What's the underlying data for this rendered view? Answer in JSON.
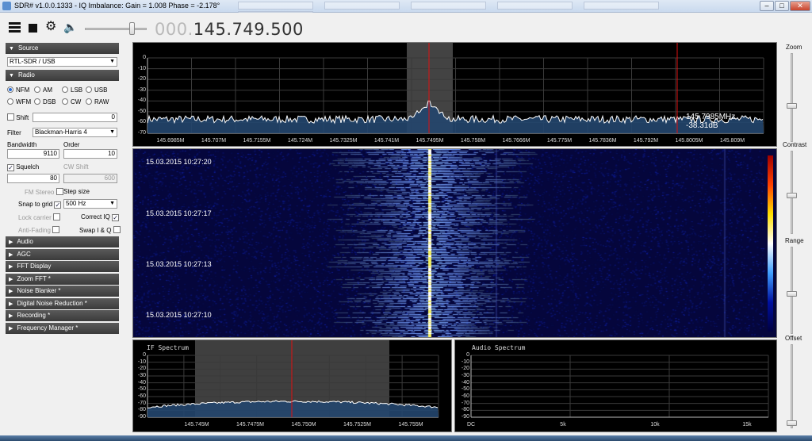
{
  "window": {
    "title": "SDR# v1.0.0.1333 - IQ Imbalance: Gain = 1.008 Phase = -2.178°",
    "min_label": "–",
    "max_label": "□",
    "close_label": "✕"
  },
  "toolbar": {
    "menu_icon": "hamburger-icon",
    "stop_icon": "stop-icon",
    "settings_icon": "gear-icon",
    "audio_icon": "speaker-icon",
    "volume": 0.75,
    "frequency_dim": "000.",
    "frequency_main": "145.749.500"
  },
  "left": {
    "source_header": "Source",
    "source_device": "RTL-SDR / USB",
    "radio_header": "Radio",
    "modes": [
      "NFM",
      "AM",
      "LSB",
      "USB",
      "WFM",
      "DSB",
      "CW",
      "RAW"
    ],
    "selected_mode": "NFM",
    "shift_label": "Shift",
    "shift_value": "0",
    "filter_label": "Filter",
    "filter_value": "Blackman-Harris 4",
    "bandwidth_label": "Bandwidth",
    "bandwidth_value": "9110",
    "order_label": "Order",
    "order_value": "10",
    "squelch_label": "Squelch",
    "squelch_value": "80",
    "cwshift_label": "CW Shift",
    "cwshift_value": "600",
    "fmstereo_label": "FM Stereo",
    "stepsize_label": "Step size",
    "snap_label": "Snap to grid",
    "step_value": "500 Hz",
    "lock_label": "Lock carrier",
    "correctiq_label": "Correct IQ",
    "antifading_label": "Anti-Fading",
    "swapiq_label": "Swap I & Q",
    "sections": [
      "Audio",
      "AGC",
      "FFT Display",
      "Zoom FFT *",
      "Noise Blanker *",
      "Digital Noise Reduction *",
      "Recording *",
      "Frequency Manager *"
    ]
  },
  "spectrum": {
    "y_ticks": [
      "0",
      "-10",
      "-20",
      "-30",
      "-40",
      "-50",
      "-60",
      "-70"
    ],
    "x_ticks": [
      "145.6985M",
      "145.707M",
      "145.7155M",
      "145.724M",
      "145.7325M",
      "145.741M",
      "145.7495M",
      "145.758M",
      "145.7666M",
      "145.775M",
      "145.7836M",
      "145.792M",
      "145.8005M",
      "145.809M"
    ],
    "cursor_freq": "145.7985MHz",
    "cursor_level": "-38.31dB"
  },
  "waterfall": {
    "timestamps": [
      "15.03.2015 10:27:20",
      "15.03.2015 10:27:17",
      "15.03.2015 10:27:13",
      "15.03.2015 10:27:10"
    ]
  },
  "if_spectrum": {
    "title": "IF Spectrum",
    "y_ticks": [
      "0",
      "-10",
      "-20",
      "-30",
      "-40",
      "-50",
      "-60",
      "-70",
      "-80",
      "-90"
    ],
    "x_ticks": [
      "145.745M",
      "145.7475M",
      "145.750M",
      "145.7525M",
      "145.755M"
    ]
  },
  "audio_spectrum": {
    "title": "Audio Spectrum",
    "y_ticks": [
      "0",
      "-10",
      "-20",
      "-30",
      "-40",
      "-50",
      "-60",
      "-70",
      "-80",
      "-90"
    ],
    "x_ticks": [
      "DC",
      "5k",
      "10k",
      "15k"
    ]
  },
  "right": {
    "zoom_label": "Zoom",
    "contrast_label": "Contrast",
    "range_label": "Range",
    "offset_label": "Offset"
  },
  "colors": {
    "cursor_red": "#e01010",
    "trace": "#ffffff",
    "fill": "#24466e"
  }
}
